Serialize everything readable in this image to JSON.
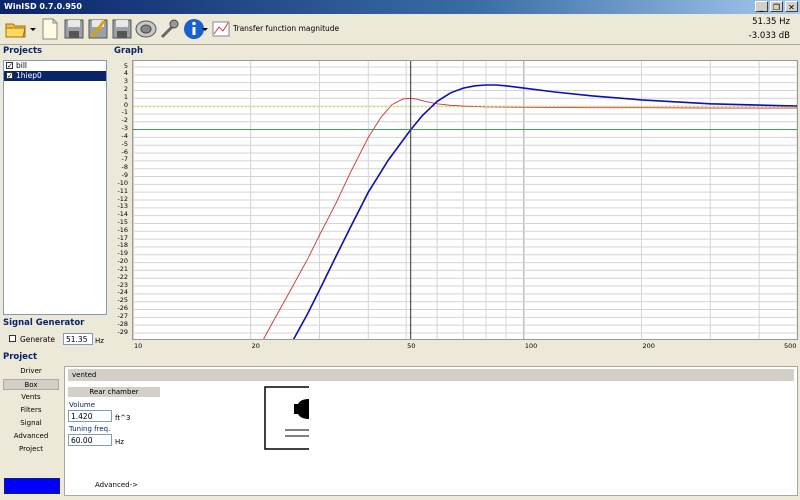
{
  "app": {
    "title": "WinISD 0.7.0.950"
  },
  "window_controls": {
    "minimize": "_",
    "restore": "❐",
    "close": "✕"
  },
  "toolbar": {
    "items": [
      {
        "icon": "open-folder-icon"
      },
      {
        "icon": "dropdown-arrow-icon"
      },
      {
        "icon": "new-document-icon"
      },
      {
        "icon": "save-icon"
      },
      {
        "icon": "save-all-icon"
      },
      {
        "icon": "save-as-icon"
      },
      {
        "icon": "speaker-driver-icon"
      },
      {
        "icon": "tools-icon"
      },
      {
        "icon": "info-icon"
      },
      {
        "icon": "dropdown-arrow-icon"
      },
      {
        "icon": "chart-icon"
      }
    ],
    "graph_selector_label": "Transfer function magnitude",
    "readout_freq": "51.35 Hz",
    "readout_db": "-3.033 dB"
  },
  "projects": {
    "heading": "Projects",
    "items": [
      {
        "label": "bill",
        "checked": true,
        "selected": false
      },
      {
        "label": "1hiep0",
        "checked": true,
        "selected": true
      }
    ]
  },
  "graph": {
    "heading": "Graph"
  },
  "chart_data": {
    "type": "line",
    "xscale": "log",
    "xlim": [
      10,
      500
    ],
    "ylim": [
      -29,
      5
    ],
    "grid": true,
    "x_ticks": [
      10,
      20,
      50,
      100,
      200,
      500
    ],
    "y_ticks": [
      5,
      4,
      3,
      2,
      1,
      0,
      -1,
      -2,
      -3,
      -4,
      -5,
      -6,
      -7,
      -8,
      -9,
      -10,
      -11,
      -12,
      -13,
      -14,
      -15,
      -16,
      -17,
      -18,
      -19,
      -20,
      -21,
      -22,
      -23,
      -24,
      -25,
      -26,
      -27,
      -28,
      -29
    ],
    "cursor_x": 51.35,
    "series": [
      {
        "color": "#cc3333",
        "width": 0.9,
        "x": [
          20,
          22,
          25,
          28,
          30,
          33,
          36,
          40,
          43,
          46,
          49,
          51,
          53,
          56,
          60,
          65,
          70,
          80,
          100,
          150,
          200,
          300,
          500
        ],
        "y": [
          -33,
          -29,
          -24,
          -19.5,
          -16.5,
          -12.5,
          -8.5,
          -4,
          -1.5,
          0.2,
          0.9,
          1.0,
          0.9,
          0.6,
          0.3,
          0.1,
          0.0,
          -0.1,
          -0.15,
          -0.2,
          -0.2,
          -0.25,
          -0.25
        ]
      },
      {
        "color": "#1010b0",
        "width": 1.6,
        "x": [
          25,
          28,
          30,
          33,
          36,
          40,
          45,
          51.35,
          55,
          60,
          65,
          70,
          75,
          80,
          85,
          90,
          100,
          120,
          150,
          200,
          300,
          500
        ],
        "y": [
          -31,
          -26.5,
          -23.5,
          -19.3,
          -15.5,
          -11,
          -6.9,
          -3.033,
          -1.2,
          0.6,
          1.7,
          2.3,
          2.6,
          2.7,
          2.7,
          2.6,
          2.3,
          1.8,
          1.3,
          0.8,
          0.3,
          0.0
        ]
      },
      {
        "color": "#e0e000",
        "width": 0.7,
        "dash": "2,2",
        "x": [
          10,
          500
        ],
        "y": [
          -0.1,
          -0.1
        ]
      },
      {
        "color": "#2f8f4f",
        "width": 0.9,
        "x": [
          10,
          500
        ],
        "y": [
          -3.0,
          -3.0
        ]
      }
    ]
  },
  "signal_generator": {
    "heading": "Signal Generator",
    "generate_label": "Generate",
    "generate_checked": false,
    "freq_value": "51.35",
    "freq_unit": "Hz"
  },
  "project_nav": {
    "heading": "Project",
    "items": [
      {
        "label": "Driver",
        "active": false
      },
      {
        "label": "Box",
        "active": true
      },
      {
        "label": "Vents",
        "active": false
      },
      {
        "label": "Filters",
        "active": false
      },
      {
        "label": "Signal",
        "active": false
      },
      {
        "label": "Advanced",
        "active": false
      },
      {
        "label": "Project",
        "active": false
      }
    ]
  },
  "box_panel": {
    "box_type": "vented",
    "rear_chamber_label": "Rear chamber",
    "volume_label": "Volume",
    "volume_value": "1.420",
    "volume_unit": "ft^3",
    "tuning_label": "Tuning freq.",
    "tuning_value": "60.00",
    "tuning_unit": "Hz",
    "advanced_link": "Advanced->"
  },
  "colors": {
    "selection": "#0a246a",
    "accent_blue": "#0000ff",
    "chrome": "#ece9d8"
  }
}
